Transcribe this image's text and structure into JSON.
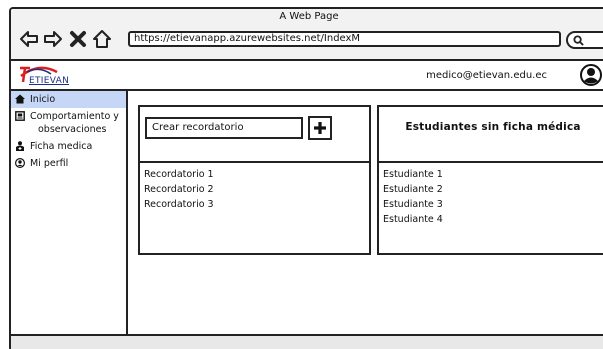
{
  "browser": {
    "title": "A Web Page",
    "url": "https://etievanapp.azurewebsites.net/IndexM",
    "icons": [
      "back-arrow-icon",
      "forward-arrow-icon",
      "close-icon",
      "home-icon",
      "search-icon"
    ]
  },
  "header": {
    "logo_text": "ETIEVAN",
    "user_email": "medico@etievan.edu.ec"
  },
  "sidebar": {
    "items": [
      {
        "label": "Inicio",
        "icon": "home-icon",
        "active": true
      },
      {
        "label": "Comportamiento y",
        "label2": "observaciones",
        "icon": "clipboard-icon",
        "active": false
      },
      {
        "label": "Ficha medica",
        "icon": "medical-icon",
        "active": false
      },
      {
        "label": "Mi perfil",
        "icon": "user-circle-icon",
        "active": false
      }
    ]
  },
  "reminders": {
    "input_value": "Crear recordatorio",
    "add_icon": "plus-icon",
    "items": [
      "Recordatorio 1",
      "Recordatorio 2",
      "Recordatorio 3"
    ]
  },
  "students": {
    "title": "Estudiantes sin ficha médica",
    "items": [
      "Estudiante 1",
      "Estudiante 2",
      "Estudiante 3",
      "Estudiante 4"
    ]
  },
  "colors": {
    "active_item": "#c6d6f7",
    "border": "#222222",
    "logo_blue": "#1a2f8a",
    "logo_red": "#d9201e"
  }
}
